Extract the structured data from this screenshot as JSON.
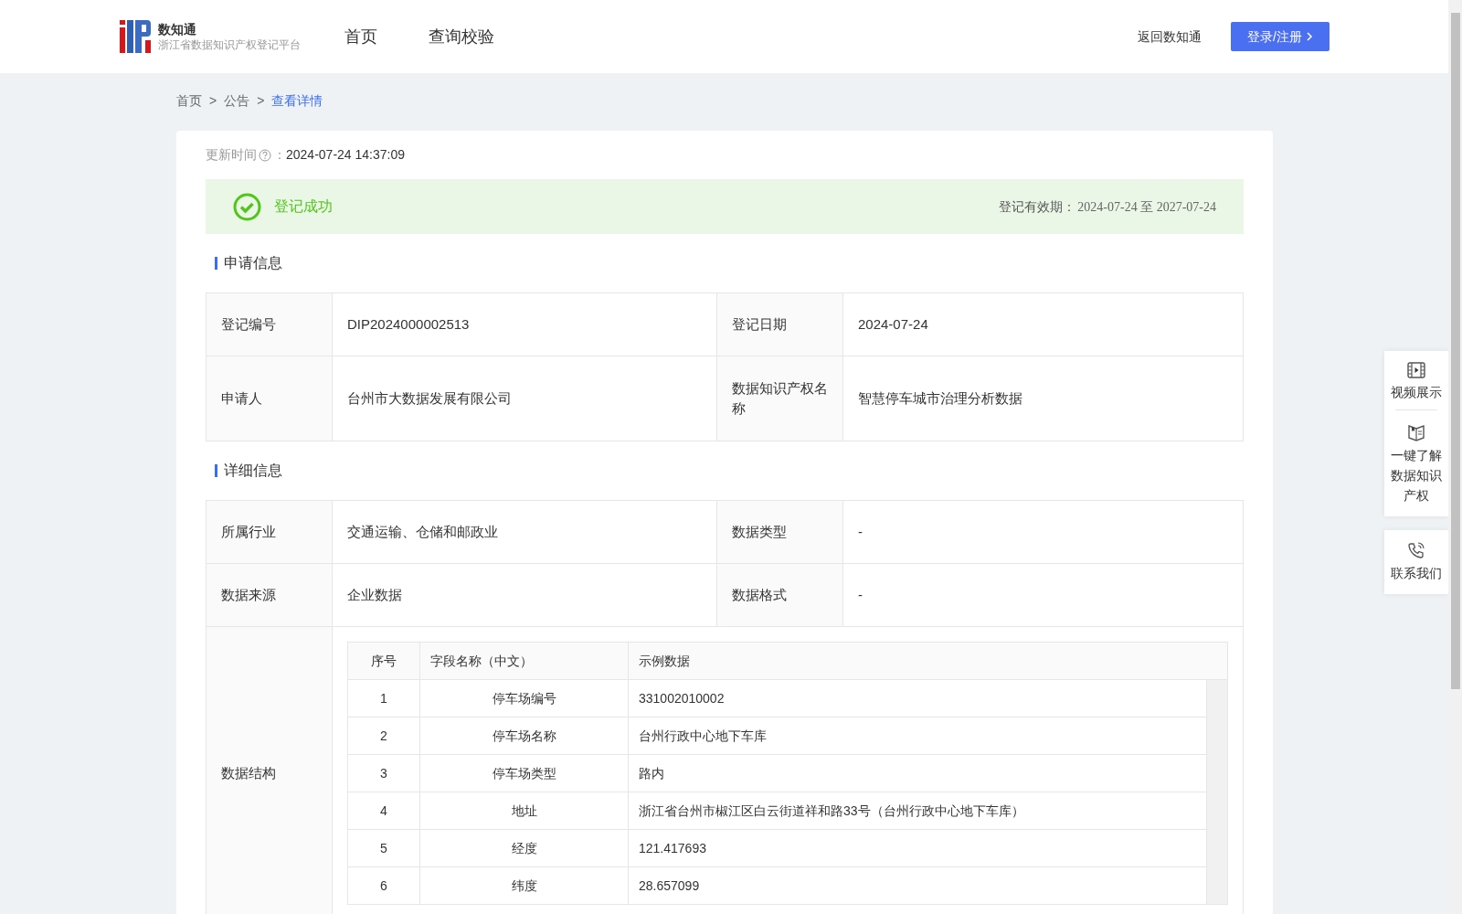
{
  "header": {
    "logo_title": "数知通",
    "logo_subtitle": "浙江省数据知识产权登记平台",
    "nav": [
      "首页",
      "查询校验"
    ],
    "back_link": "返回数知通",
    "login_button": "登录/注册"
  },
  "breadcrumb": [
    {
      "label": "首页",
      "current": false
    },
    {
      "label": "公告",
      "current": false
    },
    {
      "label": "查看详情",
      "current": true
    }
  ],
  "breadcrumb_separator": ">",
  "update_time": {
    "label": "更新时间",
    "colon": "：",
    "value": "2024-07-24 14:37:09"
  },
  "status": {
    "text": "登记成功",
    "validity_label": "登记有效期：",
    "validity_period": "2024-07-24 至 2027-07-24"
  },
  "sections": [
    {
      "title": "申请信息",
      "rows": [
        {
          "kind": "pairs",
          "cells": [
            {
              "label": "登记编号",
              "value": "DIP2024000002513"
            },
            {
              "label": "登记日期",
              "value": "2024-07-24"
            }
          ]
        },
        {
          "kind": "pairs",
          "cells": [
            {
              "label": "申请人",
              "value": "台州市大数据发展有限公司"
            },
            {
              "label": "数据知识产权名称",
              "value": "智慧停车城市治理分析数据"
            }
          ]
        }
      ]
    },
    {
      "title": "详细信息",
      "rows": [
        {
          "kind": "pairs",
          "cells": [
            {
              "label": "所属行业",
              "value": "交通运输、仓储和邮政业"
            },
            {
              "label": "数据类型",
              "value": "-"
            }
          ]
        },
        {
          "kind": "pairs",
          "cells": [
            {
              "label": "数据来源",
              "value": "企业数据"
            },
            {
              "label": "数据格式",
              "value": "-"
            }
          ]
        },
        {
          "kind": "structure",
          "label": "数据结构",
          "columns": [
            "序号",
            "字段名称（中文）",
            "示例数据"
          ],
          "rows": [
            [
              "1",
              "停车场编号",
              "331002010002"
            ],
            [
              "2",
              "停车场名称",
              "台州行政中心地下车库"
            ],
            [
              "3",
              "停车场类型",
              "路内"
            ],
            [
              "4",
              "地址",
              "浙江省台州市椒江区白云街道祥和路33号（台州行政中心地下车库）"
            ],
            [
              "5",
              "经度",
              "121.417693"
            ],
            [
              "6",
              "纬度",
              "28.657099"
            ]
          ]
        }
      ]
    }
  ],
  "side_tools": [
    {
      "label": "视频展示"
    },
    {
      "label": "一键了解数据知识产权"
    },
    {
      "label": "联系我们"
    }
  ]
}
